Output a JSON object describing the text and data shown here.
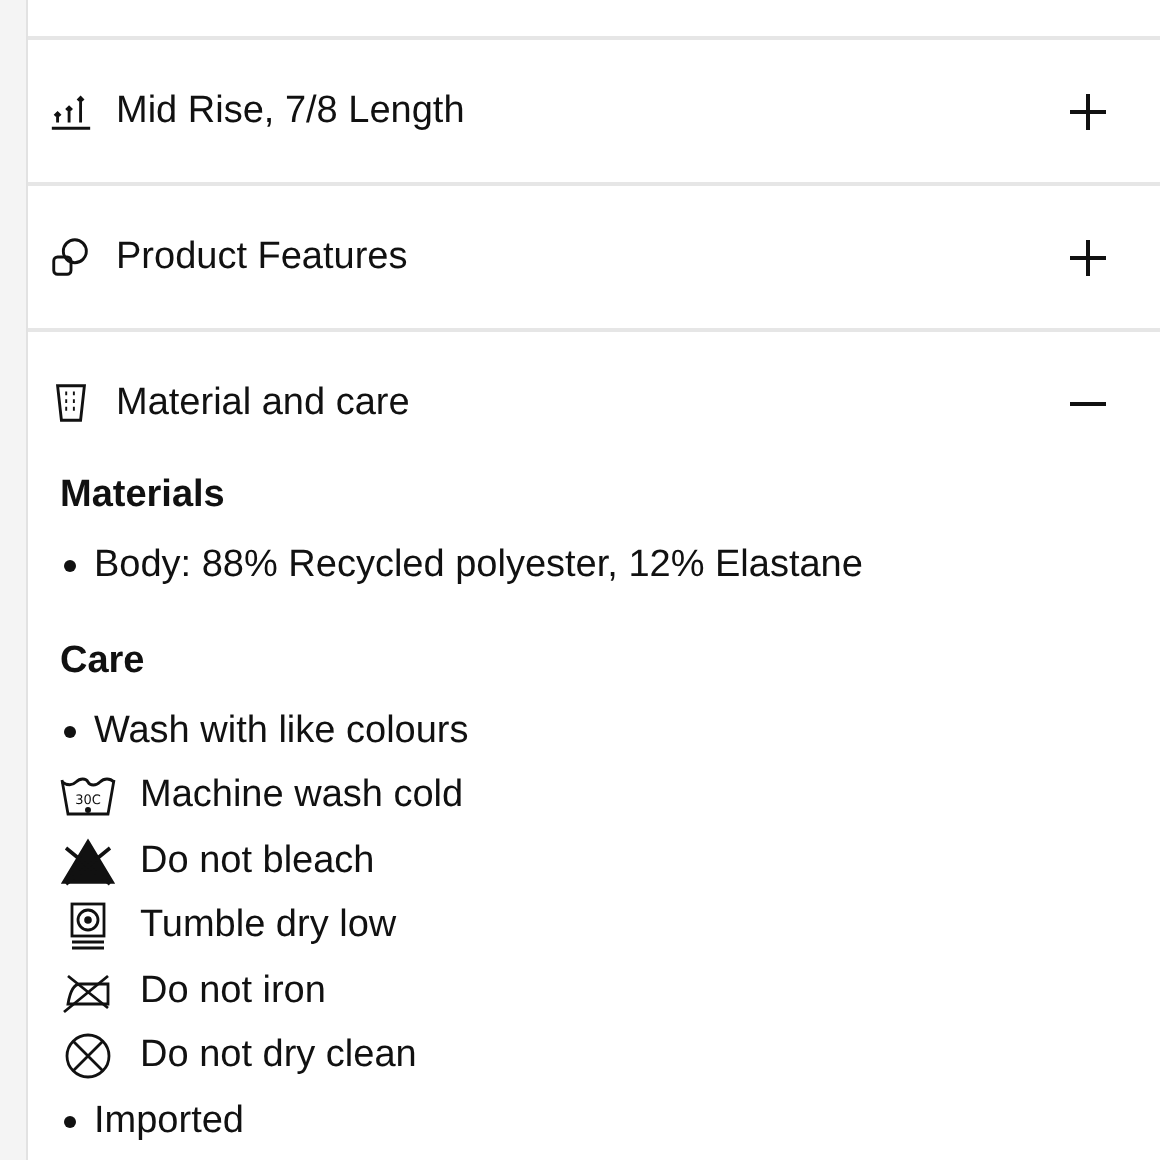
{
  "sections": [
    {
      "title": "Mid Rise, 7/8 Length",
      "kind": "rise",
      "expanded": false
    },
    {
      "title": "Product Features",
      "kind": "features",
      "expanded": false
    },
    {
      "title": "Material and care",
      "kind": "fabric",
      "expanded": true
    }
  ],
  "details": {
    "materials_heading": "Materials",
    "materials": [
      "Body: 88% Recycled polyester, 12% Elastane"
    ],
    "care_heading": "Care",
    "care": [
      {
        "kind": "bullet",
        "text": "Wash with like colours"
      },
      {
        "kind": "wash",
        "text": "Machine wash cold",
        "label": "30C"
      },
      {
        "kind": "nobleach",
        "text": "Do not bleach"
      },
      {
        "kind": "tumble",
        "text": "Tumble dry low"
      },
      {
        "kind": "noiron",
        "text": "Do not iron"
      },
      {
        "kind": "nodryclean",
        "text": "Do not dry clean"
      },
      {
        "kind": "bullet",
        "text": "Imported"
      }
    ]
  }
}
